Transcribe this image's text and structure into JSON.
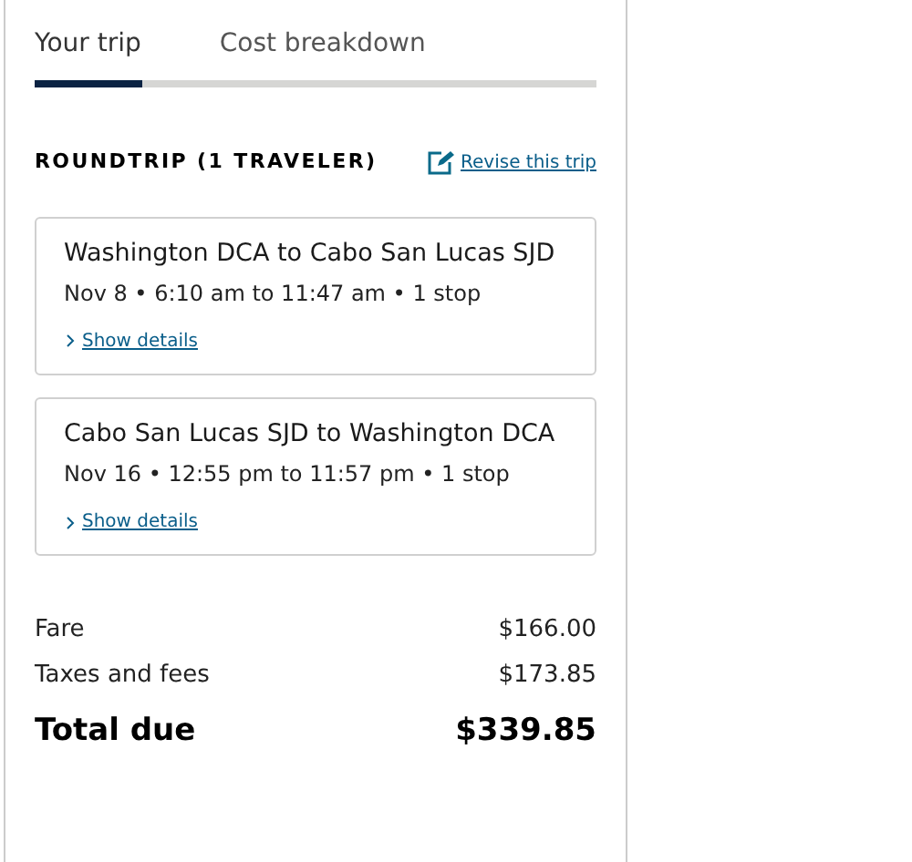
{
  "tabs": [
    {
      "label": "Your trip",
      "selected": true
    },
    {
      "label": "Cost breakdown",
      "selected": false
    }
  ],
  "summary": {
    "heading": "ROUNDTRIP (1 TRAVELER)",
    "revise_link": "Revise this trip"
  },
  "flights": [
    {
      "route": "Washington DCA to Cabo San Lucas SJD",
      "details": "Nov 8 • 6:10 am to 11:47 am • 1 stop",
      "toggle": "Show details",
      "expanded": false
    },
    {
      "route": "Cabo San Lucas SJD to Washington DCA",
      "details": "Nov 16 • 12:55 pm to 11:57 pm • 1 stop",
      "toggle": "Show details",
      "expanded": false
    }
  ],
  "costs": [
    {
      "kind": "line",
      "label": "Fare",
      "amount": "$166.00"
    },
    {
      "kind": "line",
      "label": "Taxes and fees",
      "amount": "$173.85"
    },
    {
      "kind": "total",
      "label": "Total due",
      "amount": "$339.85"
    }
  ]
}
